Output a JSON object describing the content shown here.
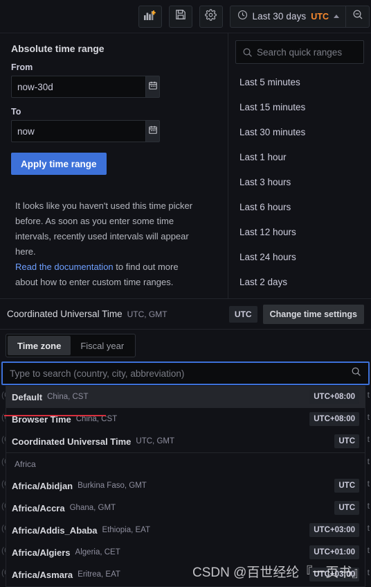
{
  "toolbar": {
    "buttons": [
      {
        "name": "add-panel-button",
        "icon": "add-panel-icon",
        "label": ""
      },
      {
        "name": "save-dashboard-button",
        "icon": "save-icon",
        "label": ""
      },
      {
        "name": "dashboard-settings-button",
        "icon": "gear-icon",
        "label": ""
      }
    ],
    "time_picker": {
      "icon": "clock-icon",
      "range_label": "Last 30 days",
      "timezone_label": "UTC",
      "caret": "chevron-up-icon"
    },
    "zoom_out": {
      "icon": "zoom-out-icon",
      "label": ""
    }
  },
  "absolute_range": {
    "title": "Absolute time range",
    "from_label": "From",
    "from_value": "now-30d",
    "to_label": "To",
    "to_value": "now",
    "calendar_icon": "calendar-icon",
    "apply_label": "Apply time range",
    "hint_text": "It looks like you haven't used this time picker before. As soon as you enter some time intervals, recently used intervals will appear here.",
    "hint_link": "Read the documentation",
    "hint_tail": " to find out more about how to enter custom time ranges."
  },
  "quick_ranges": {
    "search_placeholder": "Search quick ranges",
    "search_icon": "search-icon",
    "items": [
      "Last 5 minutes",
      "Last 15 minutes",
      "Last 30 minutes",
      "Last 1 hour",
      "Last 3 hours",
      "Last 6 hours",
      "Last 12 hours",
      "Last 24 hours",
      "Last 2 days"
    ]
  },
  "timezone_bar": {
    "name": "Coordinated Universal Time",
    "sub": "UTC, GMT",
    "offset_badge": "UTC",
    "change_label": "Change time settings"
  },
  "tabs": [
    {
      "label": "Time zone",
      "active": true
    },
    {
      "label": "Fiscal year",
      "active": false
    }
  ],
  "timezone_search": {
    "placeholder": "Type to search (country, city, abbreviation)",
    "value": "",
    "search_icon": "search-icon"
  },
  "timezone_list": [
    {
      "kind": "option",
      "name": "Default",
      "sub": "China, CST",
      "offset": "UTC+08:00",
      "highlighted": true,
      "annotated": true
    },
    {
      "kind": "option",
      "name": "Browser Time",
      "sub": "China, CST",
      "offset": "UTC+08:00",
      "highlighted": false,
      "annotated": false
    },
    {
      "kind": "option",
      "name": "Coordinated Universal Time",
      "sub": "UTC, GMT",
      "offset": "UTC",
      "highlighted": false,
      "annotated": false
    },
    {
      "kind": "group",
      "name": "Africa",
      "sub": "",
      "offset": "",
      "highlighted": false,
      "annotated": false
    },
    {
      "kind": "option",
      "name": "Africa/Abidjan",
      "sub": "Burkina Faso, GMT",
      "offset": "UTC",
      "highlighted": false,
      "annotated": false
    },
    {
      "kind": "option",
      "name": "Africa/Accra",
      "sub": "Ghana, GMT",
      "offset": "UTC",
      "highlighted": false,
      "annotated": false
    },
    {
      "kind": "option",
      "name": "Africa/Addis_Ababa",
      "sub": "Ethiopia, EAT",
      "offset": "UTC+03:00",
      "highlighted": false,
      "annotated": false
    },
    {
      "kind": "option",
      "name": "Africa/Algiers",
      "sub": "Algeria, CET",
      "offset": "UTC+01:00",
      "highlighted": false,
      "annotated": false
    },
    {
      "kind": "option",
      "name": "Africa/Asmara",
      "sub": "Eritrea, EAT",
      "offset": "UTC+03:00",
      "highlighted": false,
      "annotated": false
    }
  ],
  "watermark": {
    "text": "CSDN @百世经纶『一页书』"
  },
  "colors": {
    "accent_blue": "#3d71d9",
    "accent_orange": "#fa8a2e",
    "annotation_red": "#d9303e",
    "panel_bg": "#111217",
    "input_bg": "#0b0c0e"
  }
}
